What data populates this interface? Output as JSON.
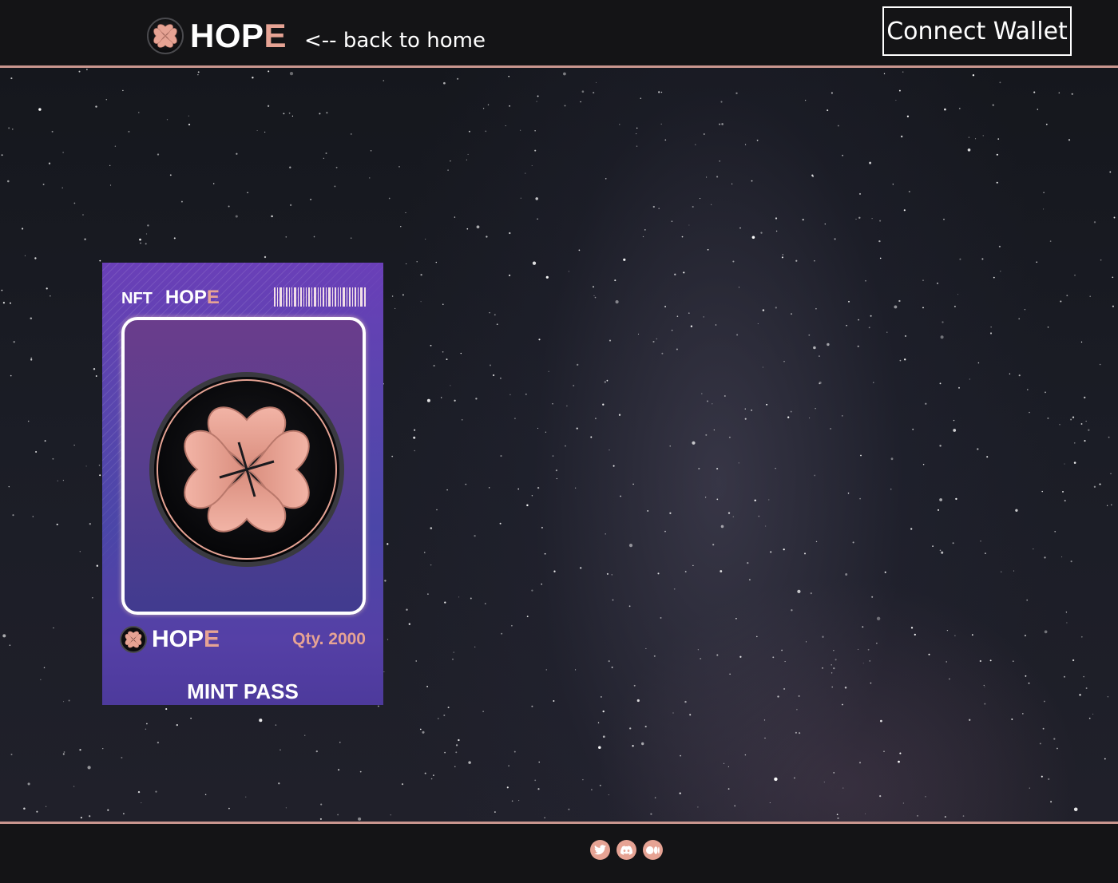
{
  "header": {
    "brand": {
      "text_main": "HOP",
      "text_accent": "E",
      "logo_icon": "clover-logo-icon"
    },
    "back_link": "<-- back to home",
    "connect_button": "Connect Wallet"
  },
  "card": {
    "nft_label": "NFT",
    "brand_main": "HOP",
    "brand_accent": "E",
    "barcode_icon": "barcode-icon",
    "emblem_icon": "clover-emblem-icon",
    "footer_brand_main": "HOP",
    "footer_brand_accent": "E",
    "quantity": "Qty. 2000",
    "title": "MINT PASS"
  },
  "footer": {
    "social_icons": [
      "twitter-icon",
      "discord-icon",
      "medium-icon"
    ]
  },
  "colors": {
    "accent": "#e6a394",
    "header_border": "#c9968e",
    "background": "#141416",
    "card_top": "#6a3fb8",
    "card_bottom": "#4d3a9c"
  }
}
